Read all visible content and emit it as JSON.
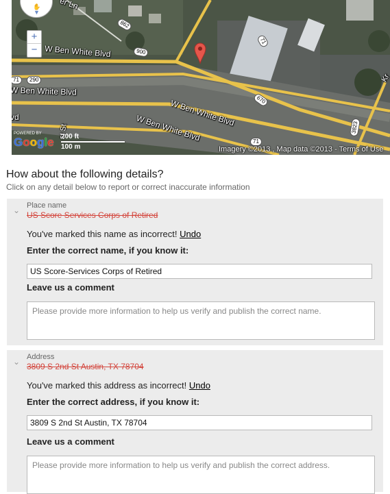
{
  "map": {
    "roads": {
      "ben_white_1": "W Ben White Blvd",
      "ben_white_2": "W Ben White Blvd",
      "ben_white_3": "W Ben White Blvd",
      "ben_white_4": "W Ben White Blvd",
      "ben_white_5": "W Ben White Blvd",
      "street_ln": "er Ln",
      "st_vertical": "st St",
      "vd": "vd",
      "kr": "Kr"
    },
    "shields": [
      "862",
      "900",
      "670",
      "71",
      "290",
      "71",
      "3823",
      "71"
    ],
    "zoom_in": "+",
    "zoom_out": "−",
    "scale_ft": "200 ft",
    "scale_m": "100 m",
    "attribution": "Imagery ©2013 , Map data ©2013 - Terms of Use",
    "powered_by": "POWERED BY",
    "logo": "Google"
  },
  "heading": "How about the following details?",
  "subheading": "Click on any detail below to report or correct inaccurate information",
  "sections": [
    {
      "label": "Place name",
      "old_value": "US Score Services Corps of Retired",
      "marked_text": "You've marked this name as incorrect!",
      "undo": "Undo",
      "correct_label": "Enter the correct name, if you know it:",
      "input_value": "US Score-Services Corps of Retired",
      "comment_label": "Leave us a comment",
      "comment_placeholder": "Please provide more information to help us verify and publish the correct name."
    },
    {
      "label": "Address",
      "old_value": "3809 S 2nd St Austin, TX 78704",
      "marked_text": "You've marked this address as incorrect!",
      "undo": "Undo",
      "correct_label": "Enter the correct address, if you know it:",
      "input_value": "3809 S 2nd St Austin, TX 78704",
      "comment_label": "Leave us a comment",
      "comment_placeholder": "Please provide more information to help us verify and publish the correct address."
    }
  ],
  "colors": {
    "strike": "#d3443b",
    "panel": "#ececec",
    "marker": "#e5564b"
  }
}
